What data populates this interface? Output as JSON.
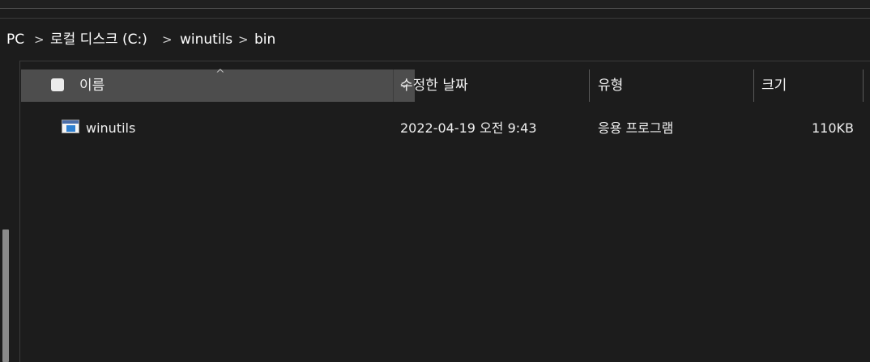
{
  "breadcrumb": {
    "items": [
      "PC",
      "로컬 디스크 (C:)",
      "winutils",
      "bin"
    ],
    "separator": ">"
  },
  "columns": {
    "name": "이름",
    "date_modified": "수정한 날짜",
    "type": "유형",
    "size": "크기",
    "sort_indicator": "^",
    "sorted_by": "name"
  },
  "files": [
    {
      "name": "winutils",
      "date_modified": "2022-04-19 오전 9:43",
      "type": "응용 프로그램",
      "size": "110KB",
      "icon": "application-exe-icon"
    }
  ],
  "colors": {
    "background": "#1c1c1c",
    "header_selected": "#4d4d4d",
    "text": "#ffffff",
    "icon_accent": "#2f80d1"
  }
}
